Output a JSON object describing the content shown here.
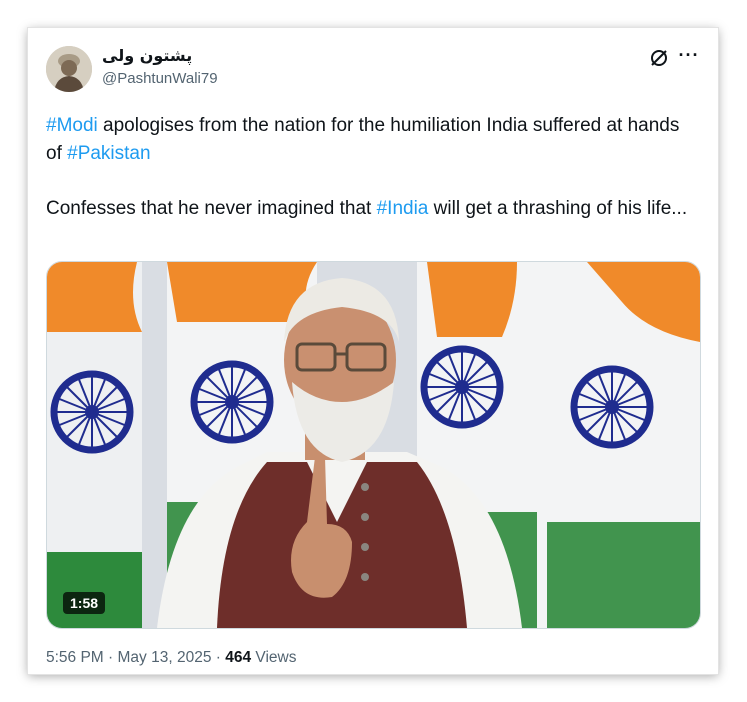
{
  "author": {
    "display_name": "پشتون ولی",
    "handle": "@PashtunWali79"
  },
  "icons": {
    "grok": "grok-icon",
    "more": "more-options-icon"
  },
  "post": {
    "p1_tag1": "#Modi",
    "p1_mid": " apologises from the nation for the humiliation India suffered at hands of ",
    "p1_tag2": "#Pakistan",
    "p2_pre": "Confesses that he never imagined that ",
    "p2_tag": "#India",
    "p2_post": " will get a thrashing of his life..."
  },
  "media": {
    "duration": "1:58"
  },
  "meta": {
    "time": "5:56 PM",
    "sep1": " · ",
    "date": "May 13, 2025",
    "sep2": " · ",
    "views_count": "464",
    "views_label": " Views"
  },
  "colors": {
    "link": "#1d9bf0",
    "secondary_text": "#536471",
    "primary_text": "#0f1419"
  }
}
